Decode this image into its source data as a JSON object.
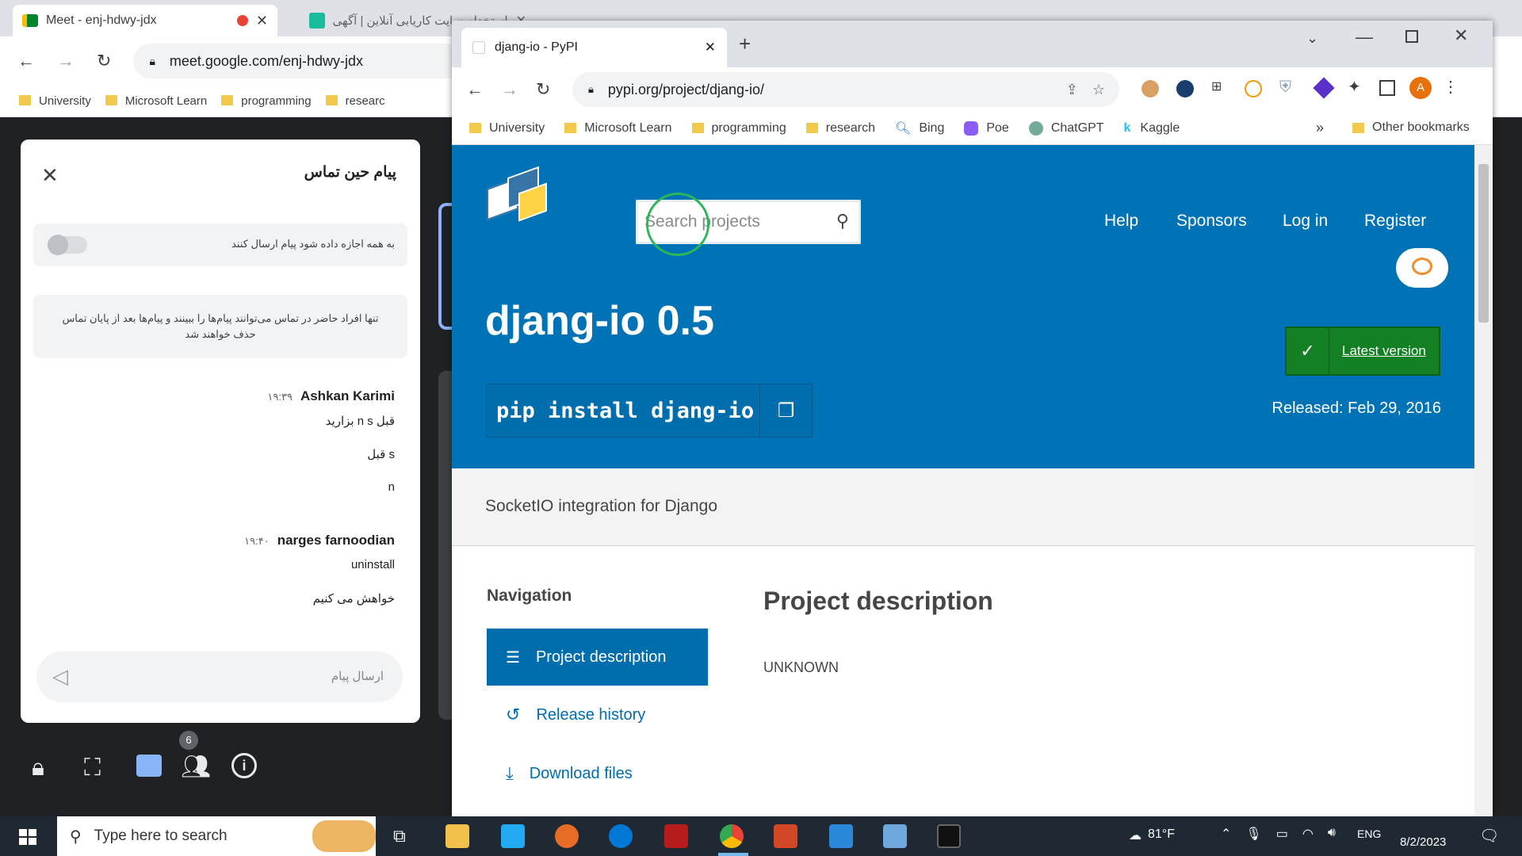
{
  "back_window": {
    "tabs": [
      {
        "label": "Meet - enj-hdwy-jdx"
      },
      {
        "label": "استخدام سایت کاریابی آنلاین | آگهی"
      }
    ],
    "url": "meet.google.com/enj-hdwy-jdx",
    "bookmarks": [
      "University",
      "Microsoft Learn",
      "programming",
      "researc"
    ]
  },
  "chat": {
    "title": "پیام حین تماس",
    "allow_toggle_label": "به همه اجازه داده شود پیام ارسال کنند",
    "notice": "تنها افراد حاضر در تماس می‌توانند پیام‌ها را ببینند و پیام‌ها بعد از پایان تماس حذف خواهند شد",
    "messages": [
      {
        "sender": "Ashkan Karimi",
        "time": "۱۹:۳۹",
        "lines": [
          "قبل n s بزارید",
          "s قبل",
          "n"
        ]
      },
      {
        "sender": "narges farnoodian",
        "time": "۱۹:۴۰",
        "lines": [
          "uninstall",
          "خواهش می کنیم"
        ]
      }
    ],
    "input_placeholder": "ارسال پیام"
  },
  "meet_controls": {
    "badge_count": "6"
  },
  "pypi_window": {
    "tab_title": "djang-io - PyPI",
    "url": "pypi.org/project/djang-io/",
    "profile_initial": "A",
    "bookmarks": [
      "University",
      "Microsoft Learn",
      "programming",
      "research",
      "Bing",
      "Poe",
      "ChatGPT",
      "Kaggle"
    ],
    "other_bookmarks": "Other bookmarks",
    "more_bookmarks": "»"
  },
  "pypi": {
    "search_placeholder": "Search projects",
    "nav": [
      "Help",
      "Sponsors",
      "Log in",
      "Register"
    ],
    "package_title": "djang-io 0.5",
    "pip_command": "pip install djang-io",
    "latest_version_label": "Latest version",
    "released": "Released: Feb 29, 2016",
    "summary": "SocketIO integration for Django",
    "navigation_heading": "Navigation",
    "sidebar": [
      {
        "label": "Project description",
        "icon": "list-icon"
      },
      {
        "label": "Release history",
        "icon": "history-icon"
      },
      {
        "label": "Download files",
        "icon": "download-icon"
      }
    ],
    "description_heading": "Project description",
    "description_body": "UNKNOWN",
    "colors": {
      "header": "#0073b7",
      "active_nav": "#006dad",
      "latest_green": "#148024"
    }
  },
  "taskbar": {
    "search_placeholder": "Type here to search",
    "weather": "81°F",
    "language": "ENG",
    "date": "8/2/2023"
  }
}
